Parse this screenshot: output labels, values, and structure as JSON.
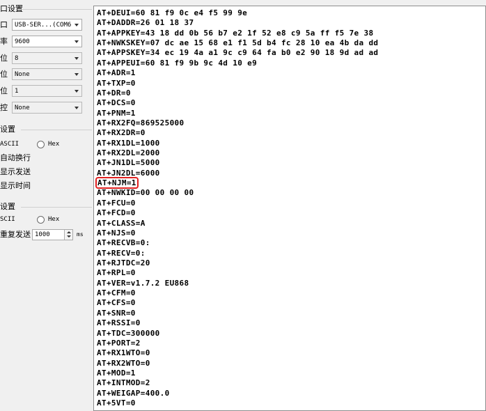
{
  "port_settings": {
    "title": "口设置",
    "rows": [
      {
        "label": "口",
        "value": "USB-SER...(COM6"
      },
      {
        "label": "率",
        "value": "9600"
      },
      {
        "label": "位",
        "value": "8"
      },
      {
        "label": "位",
        "value": "None"
      },
      {
        "label": "位",
        "value": "1"
      },
      {
        "label": "控",
        "value": "None"
      }
    ]
  },
  "receive_settings": {
    "title": "设置",
    "ascii_label": "ASCII",
    "hex_label": "Hex",
    "options": [
      "自动换行",
      "显示发送",
      "显示时间"
    ]
  },
  "send_settings": {
    "title": "设置",
    "ascii_label": "SCII",
    "hex_label": "Hex",
    "repeat_label": "重复发送",
    "interval_value": "1000",
    "interval_unit": "ms"
  },
  "output": {
    "highlighted_index": 17,
    "highlight_color": "#e02020",
    "lines": [
      "AT+DEUI=60 81 f9 0c e4 f5 99 9e",
      "AT+DADDR=26 01 18 37",
      "AT+APPKEY=43 18 dd 0b 56 b7 e2 1f 52 e8 c9 5a ff f5 7e 38",
      "AT+NWKSKEY=07 dc ae 15 68 e1 f1 5d b4 fc 28 10 ea 4b da dd",
      "AT+APPSKEY=34 ec 19 4a a1 9c c9 64 fa b0 e2 90 18 9d ad ad",
      "AT+APPEUI=60 81 f9 9b 9c 4d 10 e9",
      "AT+ADR=1",
      "AT+TXP=0",
      "AT+DR=0",
      "AT+DCS=0",
      "AT+PNM=1",
      "AT+RX2FQ=869525000",
      "AT+RX2DR=0",
      "AT+RX1DL=1000",
      "AT+RX2DL=2000",
      "AT+JN1DL=5000",
      "AT+JN2DL=6000",
      "AT+NJM=1",
      "AT+NWKID=00 00 00 00",
      "AT+FCU=0",
      "AT+FCD=0",
      "AT+CLASS=A",
      "AT+NJS=0",
      "AT+RECVB=0:",
      "AT+RECV=0:",
      "AT+RJTDC=20",
      "AT+RPL=0",
      "AT+VER=v1.7.2 EU868",
      "AT+CFM=0",
      "AT+CFS=0",
      "AT+SNR=0",
      "AT+RSSI=0",
      "AT+TDC=300000",
      "AT+PORT=2",
      "AT+RX1WTO=0",
      "AT+RX2WTO=0",
      "AT+MOD=1",
      "AT+INTMOD=2",
      "AT+WEIGAP=400.0",
      "AT+5VT=0"
    ]
  }
}
